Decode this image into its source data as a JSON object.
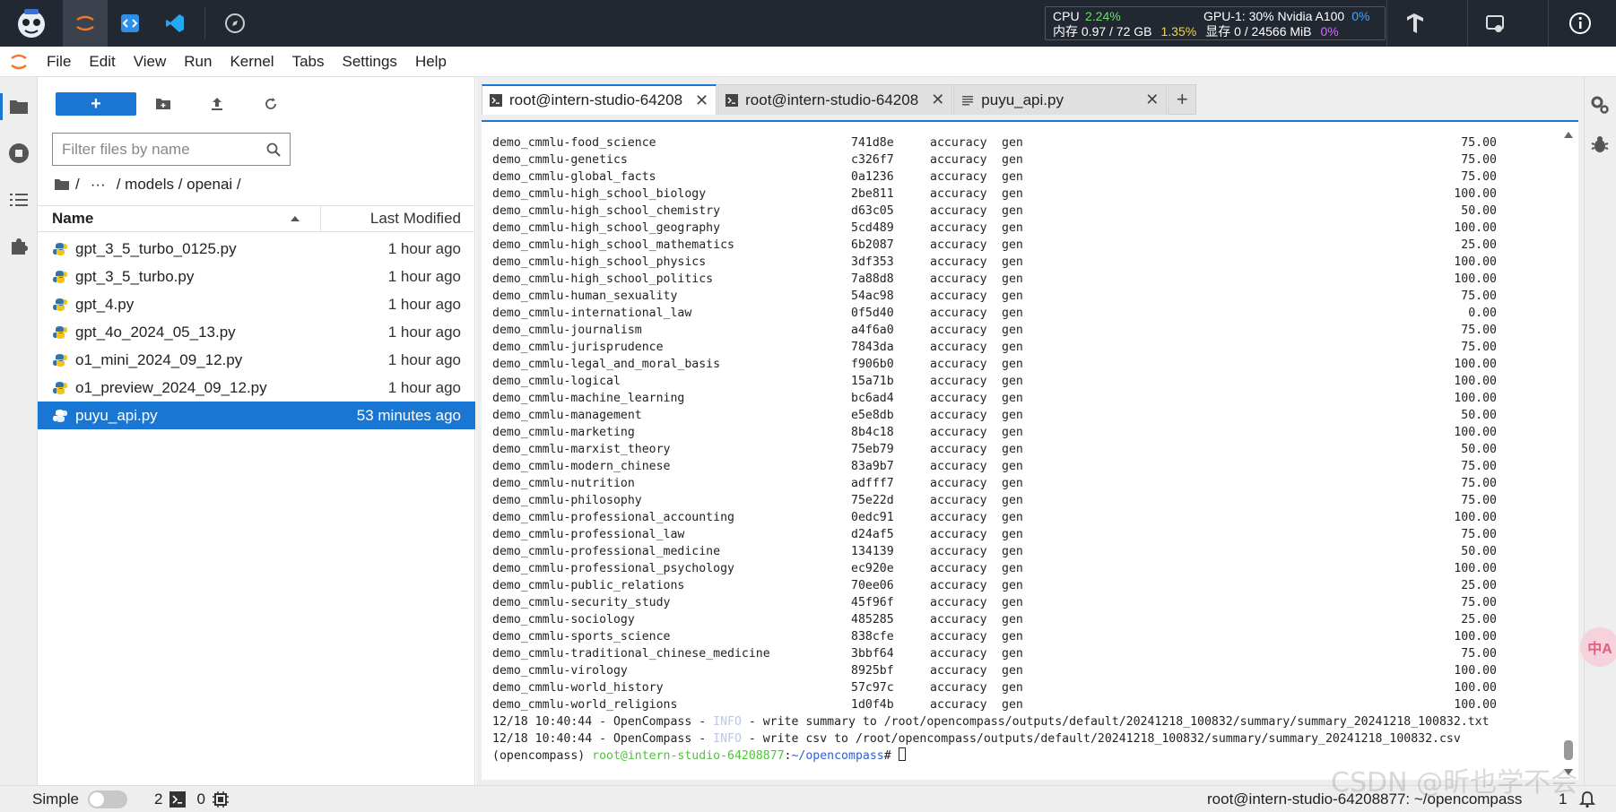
{
  "topbar": {
    "stats": {
      "cpu_label": "CPU",
      "cpu_value": "2.24%",
      "gpu_label": "GPU-1: 30% Nvidia A100",
      "gpu_value": "0%",
      "mem_label": "内存 0.97 / 72 GB",
      "mem_value": "1.35%",
      "vram_label": "显存 0 / 24566 MiB",
      "vram_value": "0%"
    }
  },
  "menubar": {
    "items": [
      "File",
      "Edit",
      "View",
      "Run",
      "Kernel",
      "Tabs",
      "Settings",
      "Help"
    ]
  },
  "filebrowser": {
    "new_label": "+",
    "filter_placeholder": "Filter files by name",
    "breadcrumb": {
      "root": "/",
      "ellipsis": "···",
      "path": "/ models / openai /"
    },
    "columns": {
      "name": "Name",
      "modified": "Last Modified"
    },
    "files": [
      {
        "name": "gpt_3_5_turbo_0125.py",
        "modified": "1 hour ago"
      },
      {
        "name": "gpt_3_5_turbo.py",
        "modified": "1 hour ago"
      },
      {
        "name": "gpt_4.py",
        "modified": "1 hour ago"
      },
      {
        "name": "gpt_4o_2024_05_13.py",
        "modified": "1 hour ago"
      },
      {
        "name": "o1_mini_2024_09_12.py",
        "modified": "1 hour ago"
      },
      {
        "name": "o1_preview_2024_09_12.py",
        "modified": "1 hour ago"
      },
      {
        "name": "puyu_api.py",
        "modified": "53 minutes ago",
        "selected": true
      }
    ]
  },
  "tabs": [
    {
      "label": "root@intern-studio-64208",
      "icon": "terminal-icon",
      "active": true
    },
    {
      "label": "root@intern-studio-64208",
      "icon": "terminal-icon",
      "active": false
    },
    {
      "label": "puyu_api.py",
      "icon": "file-text-icon",
      "active": false
    }
  ],
  "terminal": {
    "rows": [
      {
        "dataset": "demo_cmmlu-food_science",
        "version": "741d8e",
        "metric": "accuracy",
        "mode": "gen",
        "score": "75.00"
      },
      {
        "dataset": "demo_cmmlu-genetics",
        "version": "c326f7",
        "metric": "accuracy",
        "mode": "gen",
        "score": "75.00"
      },
      {
        "dataset": "demo_cmmlu-global_facts",
        "version": "0a1236",
        "metric": "accuracy",
        "mode": "gen",
        "score": "75.00"
      },
      {
        "dataset": "demo_cmmlu-high_school_biology",
        "version": "2be811",
        "metric": "accuracy",
        "mode": "gen",
        "score": "100.00"
      },
      {
        "dataset": "demo_cmmlu-high_school_chemistry",
        "version": "d63c05",
        "metric": "accuracy",
        "mode": "gen",
        "score": "50.00"
      },
      {
        "dataset": "demo_cmmlu-high_school_geography",
        "version": "5cd489",
        "metric": "accuracy",
        "mode": "gen",
        "score": "100.00"
      },
      {
        "dataset": "demo_cmmlu-high_school_mathematics",
        "version": "6b2087",
        "metric": "accuracy",
        "mode": "gen",
        "score": "25.00"
      },
      {
        "dataset": "demo_cmmlu-high_school_physics",
        "version": "3df353",
        "metric": "accuracy",
        "mode": "gen",
        "score": "100.00"
      },
      {
        "dataset": "demo_cmmlu-high_school_politics",
        "version": "7a88d8",
        "metric": "accuracy",
        "mode": "gen",
        "score": "100.00"
      },
      {
        "dataset": "demo_cmmlu-human_sexuality",
        "version": "54ac98",
        "metric": "accuracy",
        "mode": "gen",
        "score": "75.00"
      },
      {
        "dataset": "demo_cmmlu-international_law",
        "version": "0f5d40",
        "metric": "accuracy",
        "mode": "gen",
        "score": "0.00"
      },
      {
        "dataset": "demo_cmmlu-journalism",
        "version": "a4f6a0",
        "metric": "accuracy",
        "mode": "gen",
        "score": "75.00"
      },
      {
        "dataset": "demo_cmmlu-jurisprudence",
        "version": "7843da",
        "metric": "accuracy",
        "mode": "gen",
        "score": "75.00"
      },
      {
        "dataset": "demo_cmmlu-legal_and_moral_basis",
        "version": "f906b0",
        "metric": "accuracy",
        "mode": "gen",
        "score": "100.00"
      },
      {
        "dataset": "demo_cmmlu-logical",
        "version": "15a71b",
        "metric": "accuracy",
        "mode": "gen",
        "score": "100.00"
      },
      {
        "dataset": "demo_cmmlu-machine_learning",
        "version": "bc6ad4",
        "metric": "accuracy",
        "mode": "gen",
        "score": "100.00"
      },
      {
        "dataset": "demo_cmmlu-management",
        "version": "e5e8db",
        "metric": "accuracy",
        "mode": "gen",
        "score": "50.00"
      },
      {
        "dataset": "demo_cmmlu-marketing",
        "version": "8b4c18",
        "metric": "accuracy",
        "mode": "gen",
        "score": "100.00"
      },
      {
        "dataset": "demo_cmmlu-marxist_theory",
        "version": "75eb79",
        "metric": "accuracy",
        "mode": "gen",
        "score": "50.00"
      },
      {
        "dataset": "demo_cmmlu-modern_chinese",
        "version": "83a9b7",
        "metric": "accuracy",
        "mode": "gen",
        "score": "75.00"
      },
      {
        "dataset": "demo_cmmlu-nutrition",
        "version": "adfff7",
        "metric": "accuracy",
        "mode": "gen",
        "score": "75.00"
      },
      {
        "dataset": "demo_cmmlu-philosophy",
        "version": "75e22d",
        "metric": "accuracy",
        "mode": "gen",
        "score": "75.00"
      },
      {
        "dataset": "demo_cmmlu-professional_accounting",
        "version": "0edc91",
        "metric": "accuracy",
        "mode": "gen",
        "score": "100.00"
      },
      {
        "dataset": "demo_cmmlu-professional_law",
        "version": "d24af5",
        "metric": "accuracy",
        "mode": "gen",
        "score": "75.00"
      },
      {
        "dataset": "demo_cmmlu-professional_medicine",
        "version": "134139",
        "metric": "accuracy",
        "mode": "gen",
        "score": "50.00"
      },
      {
        "dataset": "demo_cmmlu-professional_psychology",
        "version": "ec920e",
        "metric": "accuracy",
        "mode": "gen",
        "score": "100.00"
      },
      {
        "dataset": "demo_cmmlu-public_relations",
        "version": "70ee06",
        "metric": "accuracy",
        "mode": "gen",
        "score": "25.00"
      },
      {
        "dataset": "demo_cmmlu-security_study",
        "version": "45f96f",
        "metric": "accuracy",
        "mode": "gen",
        "score": "75.00"
      },
      {
        "dataset": "demo_cmmlu-sociology",
        "version": "485285",
        "metric": "accuracy",
        "mode": "gen",
        "score": "25.00"
      },
      {
        "dataset": "demo_cmmlu-sports_science",
        "version": "838cfe",
        "metric": "accuracy",
        "mode": "gen",
        "score": "100.00"
      },
      {
        "dataset": "demo_cmmlu-traditional_chinese_medicine",
        "version": "3bbf64",
        "metric": "accuracy",
        "mode": "gen",
        "score": "75.00"
      },
      {
        "dataset": "demo_cmmlu-virology",
        "version": "8925bf",
        "metric": "accuracy",
        "mode": "gen",
        "score": "100.00"
      },
      {
        "dataset": "demo_cmmlu-world_history",
        "version": "57c97c",
        "metric": "accuracy",
        "mode": "gen",
        "score": "100.00"
      },
      {
        "dataset": "demo_cmmlu-world_religions",
        "version": "1d0f4b",
        "metric": "accuracy",
        "mode": "gen",
        "score": "100.00"
      }
    ],
    "log_lines": [
      {
        "prefix": "12/18 10:40:44 - OpenCompass - ",
        "level": "INFO",
        "message": " - write summary to /root/opencompass/outputs/default/20241218_100832/summary/summary_20241218_100832.txt"
      },
      {
        "prefix": "12/18 10:40:44 - OpenCompass - ",
        "level": "INFO",
        "message": " - write csv to /root/opencompass/outputs/default/20241218_100832/summary/summary_20241218_100832.csv"
      }
    ],
    "prompt": {
      "env": "(opencompass) ",
      "user_host": "root@intern-studio-64208877",
      "separator": ":",
      "path": "~/opencompass",
      "symbol": "# "
    }
  },
  "statusbar": {
    "simple_label": "Simple",
    "terminal_count": "2",
    "kernel_count": "0",
    "path": "root@intern-studio-64208877: ~/opencompass",
    "notifications": "1"
  },
  "watermark": "CSDN @昕也学不会",
  "translate_badge": "中A"
}
